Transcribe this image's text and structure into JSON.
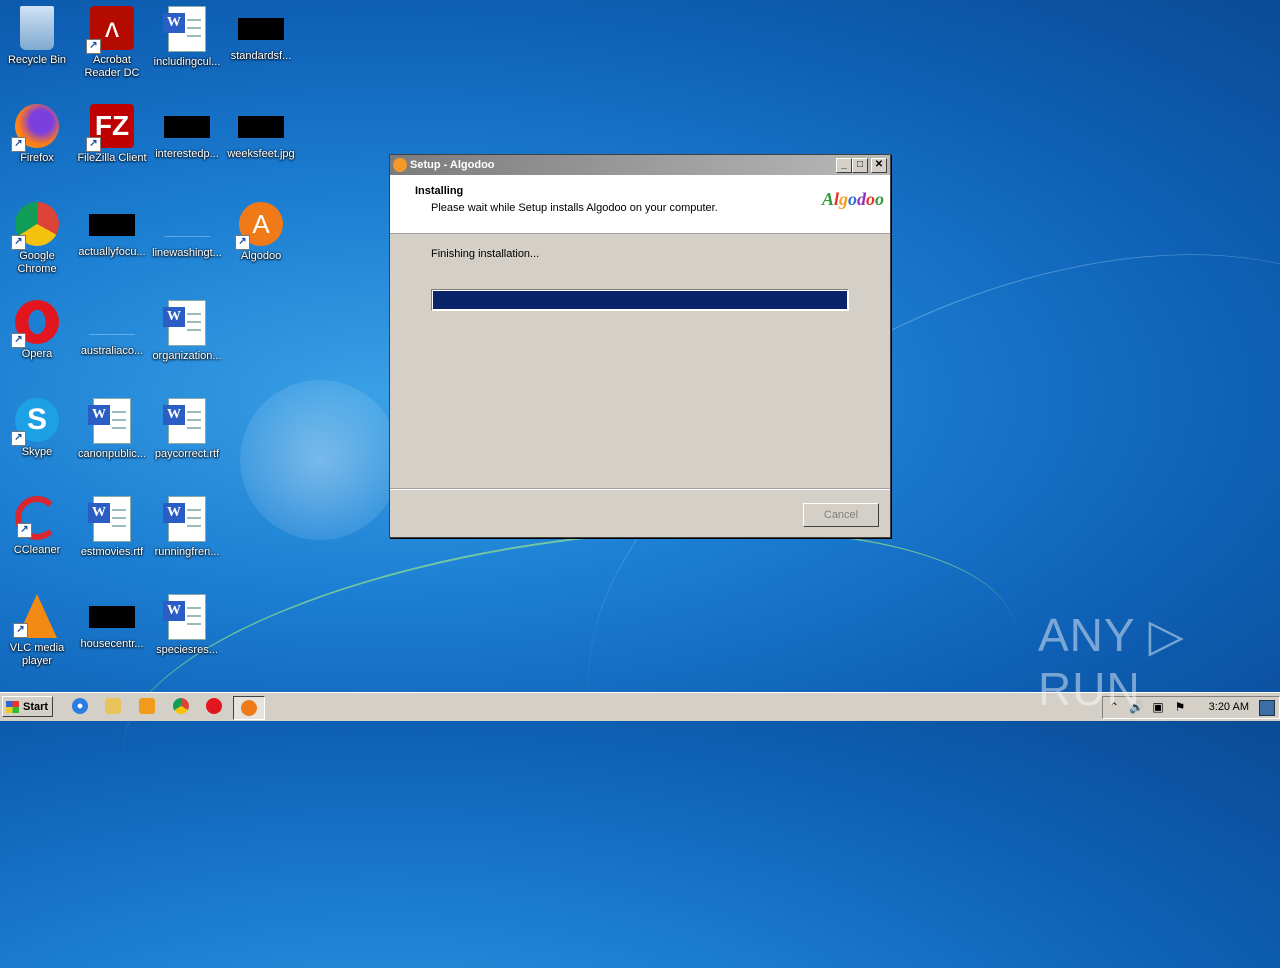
{
  "desktop": {
    "icons": [
      {
        "label": "Recycle Bin"
      },
      {
        "label": "Acrobat Reader DC"
      },
      {
        "label": "includingcul..."
      },
      {
        "label": "standardsf..."
      },
      {
        "label": "Firefox"
      },
      {
        "label": "FileZilla Client"
      },
      {
        "label": "interestedp..."
      },
      {
        "label": "weeksfeet.jpg"
      },
      {
        "label": "Google Chrome"
      },
      {
        "label": "actuallyfocu..."
      },
      {
        "label": "linewashingt..."
      },
      {
        "label": "Algodoo"
      },
      {
        "label": "Opera"
      },
      {
        "label": "australiaco..."
      },
      {
        "label": "organization..."
      },
      {
        "label": "Skype"
      },
      {
        "label": "canonpublic..."
      },
      {
        "label": "paycorrect.rtf"
      },
      {
        "label": "CCleaner"
      },
      {
        "label": "estmovies.rtf"
      },
      {
        "label": "runningfren..."
      },
      {
        "label": "VLC media player"
      },
      {
        "label": "housecentr..."
      },
      {
        "label": "speciesres..."
      }
    ]
  },
  "dialog": {
    "title": "Setup - Algodoo",
    "heading": "Installing",
    "subheading": "Please wait while Setup installs Algodoo on your computer.",
    "logo_text": "Algodoo",
    "status": "Finishing installation...",
    "progress_percent": 100,
    "cancel_label": "Cancel",
    "minimize_glyph": "_",
    "maximize_glyph": "□",
    "close_glyph": "✕"
  },
  "taskbar": {
    "start_label": "Start",
    "clock": "3:20 AM"
  },
  "watermark": "ANY ▷ RUN",
  "colors": {
    "progress_fill": "#0a246a",
    "dialog_bg": "#d4d0c8"
  }
}
